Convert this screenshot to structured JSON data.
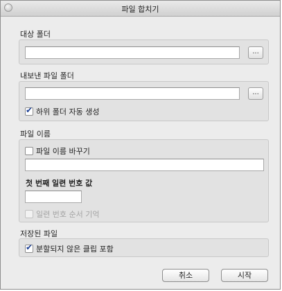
{
  "window": {
    "title": "파일 합치기"
  },
  "target_folder": {
    "label": "대상 폴더",
    "value": "",
    "browse_label": "..."
  },
  "export_folder": {
    "label": "내보낸 파일 폴더",
    "value": "",
    "browse_label": "...",
    "auto_create_label": "하위 폴더 자동 생성",
    "auto_create_checked": true
  },
  "file_name": {
    "label": "파일 이름",
    "rename_label": "파일 이름 바꾸기",
    "rename_checked": false,
    "name_value": "",
    "first_serial_label": "첫 번째 일련 번호 값",
    "serial_value": "",
    "remember_order_label": "일련 번호 순서 기억",
    "remember_order_checked": false
  },
  "saved_file": {
    "label": "저장된 파일",
    "include_unsplit_label": "분할되지 않은 클립 포함",
    "include_unsplit_checked": true
  },
  "buttons": {
    "cancel": "취소",
    "start": "시작"
  }
}
